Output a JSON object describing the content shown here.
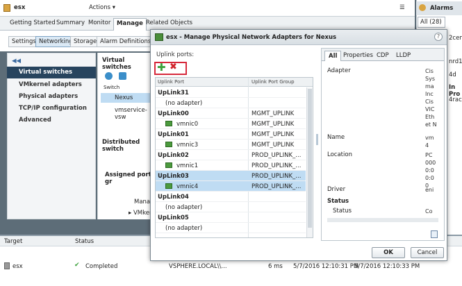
{
  "app": {
    "host_label": "esx",
    "actions_label": "Actions ▾"
  },
  "tabs": [
    "Getting Started",
    "Summary",
    "Monitor",
    "Manage",
    "Related Objects"
  ],
  "subtabs": [
    "Settings",
    "Networking",
    "Storage",
    "Alarm Definitions"
  ],
  "left_nav": {
    "collapse": "◀◀",
    "items": [
      "Virtual switches",
      "VMkernel adapters",
      "Physical adapters",
      "TCP/IP configuration",
      "Advanced"
    ]
  },
  "center": {
    "virtual_switches_label": "Virtual switches",
    "switch_col": "Switch",
    "switch_rows": [
      "Nexus",
      "vmservice-vsw"
    ],
    "distributed_label": "Distributed switch",
    "assigned_label": "Assigned port gr",
    "mana_label": "Mana",
    "vmker_label": "▸ VMker"
  },
  "alarms": {
    "title": "Alarms",
    "all_tab": "All (28)",
    "items": [
      "2cen",
      "nrd1_1",
      "4d",
      "In Pro",
      "4rac"
    ]
  },
  "dialog": {
    "title": "esx                - Manage Physical Network Adapters for Nexus",
    "help": "?",
    "uplink_ports_label": "Uplink ports:",
    "columns": [
      "Uplink Port",
      "Uplink Port Group"
    ],
    "rows": [
      {
        "name": "UpLink31",
        "adapter": "(no adapter)",
        "group": "",
        "nic": false
      },
      {
        "name": "UpLink00",
        "adapter": "vmnic0",
        "group": "MGMT_UPLINK",
        "nic": true
      },
      {
        "name": "UpLink01",
        "adapter": "vmnic3",
        "group": "MGMT_UPLINK",
        "nic": true
      },
      {
        "name": "UpLink02",
        "adapter": "vmnic1",
        "group": "PROD_UPLINK_...",
        "nic": true
      },
      {
        "name": "UpLink03",
        "adapter": "vmnic4",
        "group": "PROD_UPLINK_...",
        "nic": true,
        "selected": true
      },
      {
        "name": "UpLink04",
        "adapter": "(no adapter)",
        "group": "",
        "nic": false
      },
      {
        "name": "UpLink05",
        "adapter": "(no adapter)",
        "group": "",
        "nic": false
      }
    ],
    "detail_tabs": [
      "All",
      "Properties",
      "CDP",
      "LLDP"
    ],
    "properties": {
      "adapter_label": "Adapter",
      "adapter_value": "Cis\nSys\nma\nInc\nCis\nVIC\nEth\net N",
      "name_label": "Name",
      "name_value": "vm\n4",
      "location_label": "Location",
      "location_value": "PC\n000\n0:0\n0:0\n0",
      "driver_label": "Driver",
      "driver_value": "eni",
      "status_header": "Status",
      "status_label": "Status",
      "status_value": "Co"
    },
    "ok_label": "OK",
    "cancel_label": "Cancel"
  },
  "tasks": {
    "columns": [
      "Target",
      "Status"
    ],
    "row": {
      "target": "esx",
      "status": "Completed",
      "initiator": "VSPHERE.LOCAL\\\\...",
      "duration": "6 ms",
      "start": "5/7/2016 12:10:31 PM",
      "end": "5/7/2016 12:10:33 PM"
    }
  }
}
